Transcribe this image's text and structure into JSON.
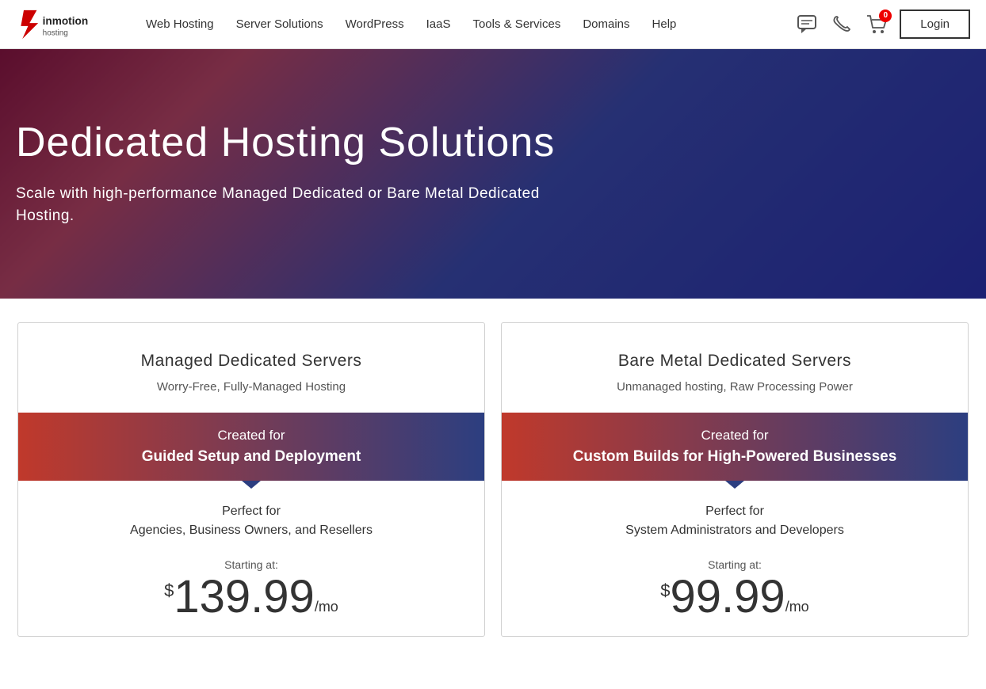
{
  "brand": {
    "name": "InMotion Hosting",
    "logo_text": "inmotion hosting"
  },
  "nav": {
    "links": [
      {
        "label": "Web Hosting",
        "id": "web-hosting"
      },
      {
        "label": "Server Solutions",
        "id": "server-solutions"
      },
      {
        "label": "WordPress",
        "id": "wordpress"
      },
      {
        "label": "IaaS",
        "id": "iaas"
      },
      {
        "label": "Tools & Services",
        "id": "tools-services"
      },
      {
        "label": "Domains",
        "id": "domains"
      },
      {
        "label": "Help",
        "id": "help"
      }
    ],
    "cart_count": "0",
    "login_label": "Login"
  },
  "hero": {
    "title": "Dedicated Hosting Solutions",
    "subtitle": "Scale with high-performance Managed Dedicated or Bare Metal Dedicated Hosting."
  },
  "cards": [
    {
      "id": "managed",
      "title": "Managed Dedicated Servers",
      "subtitle": "Worry-Free, Fully-Managed Hosting",
      "banner_line1": "Created for",
      "banner_line2": "Guided Setup and Deployment",
      "perfect_label": "Perfect for",
      "perfect_value": "Agencies, Business Owners, and Resellers",
      "starting_at": "Starting at:",
      "price_dollar": "$",
      "price_amount": "139.99",
      "price_mo": "/mo"
    },
    {
      "id": "bare-metal",
      "title": "Bare Metal Dedicated Servers",
      "subtitle": "Unmanaged hosting, Raw Processing Power",
      "banner_line1": "Created for",
      "banner_line2": "Custom Builds for High-Powered Businesses",
      "perfect_label": "Perfect for",
      "perfect_value": "System Administrators and Developers",
      "starting_at": "Starting at:",
      "price_dollar": "$",
      "price_amount": "99.99",
      "price_mo": "/mo"
    }
  ]
}
